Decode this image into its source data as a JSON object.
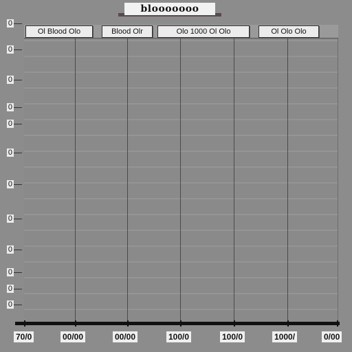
{
  "window": {
    "title": "blooooooo"
  },
  "table": {
    "columns": [
      {
        "label": "Ol Blood Olo"
      },
      {
        "label": "Blood Olr"
      },
      {
        "label": "Olo 1000 Ol Olo"
      },
      {
        "label": "Ol Olo Olo"
      }
    ]
  },
  "y_axis": {
    "labels": [
      "0",
      "0",
      "0",
      "0",
      "0",
      "0",
      "0",
      "0",
      "0",
      "0",
      "0",
      "0"
    ]
  },
  "x_axis": {
    "labels": [
      "70/0",
      "00/00",
      "00/00",
      "100/0",
      "100/0",
      "1000/",
      "0/00"
    ]
  },
  "colors": {
    "background": "#8c8c8c",
    "grid_line": "#4a4a4a",
    "button_face": "#ececec",
    "axis": "#111111"
  }
}
